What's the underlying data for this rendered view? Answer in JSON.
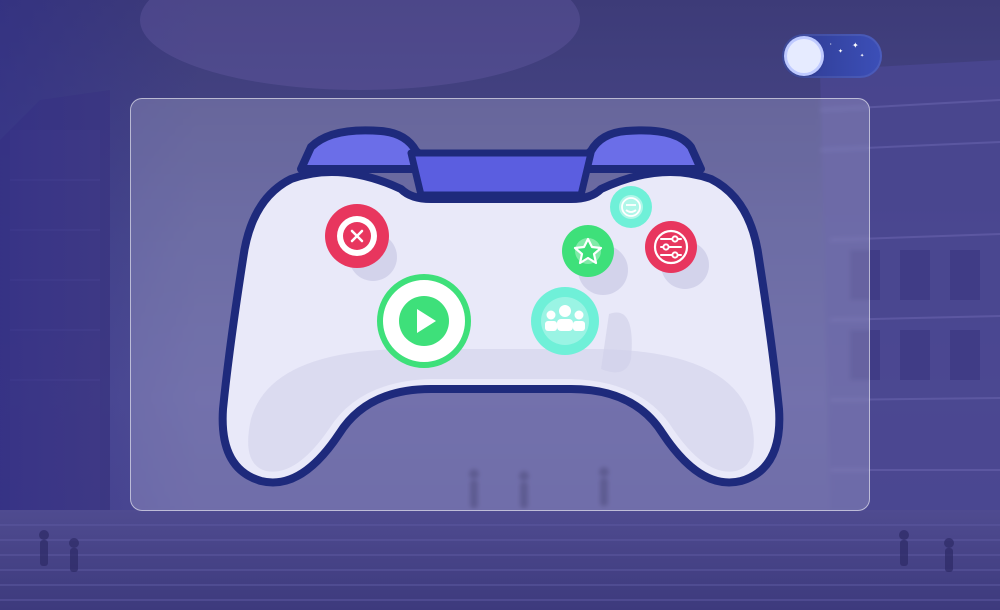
{
  "theme_toggle": {
    "state": "night",
    "track_color": "#3346a6",
    "knob_color": "#e6ebff"
  },
  "card": {
    "style": "frosted-glass"
  },
  "gamepad": {
    "body_color": "#e8e8f8",
    "outline_color": "#1e2a7c",
    "bumper_color": "#6b6ee8",
    "buttons": [
      {
        "name": "close-button",
        "icon": "x-icon",
        "color": "#e8365e"
      },
      {
        "name": "play-button",
        "icon": "play-icon",
        "color": "#3ee07a"
      },
      {
        "name": "favorite-button",
        "icon": "star-icon",
        "color": "#3ee07a"
      },
      {
        "name": "chat-button",
        "icon": "emoji-icon",
        "color": "#6ff0d8"
      },
      {
        "name": "settings-button",
        "icon": "sliders-icon",
        "color": "#e8365e"
      },
      {
        "name": "multiplayer-button",
        "icon": "group-icon",
        "color": "#6ff0d8"
      }
    ]
  }
}
